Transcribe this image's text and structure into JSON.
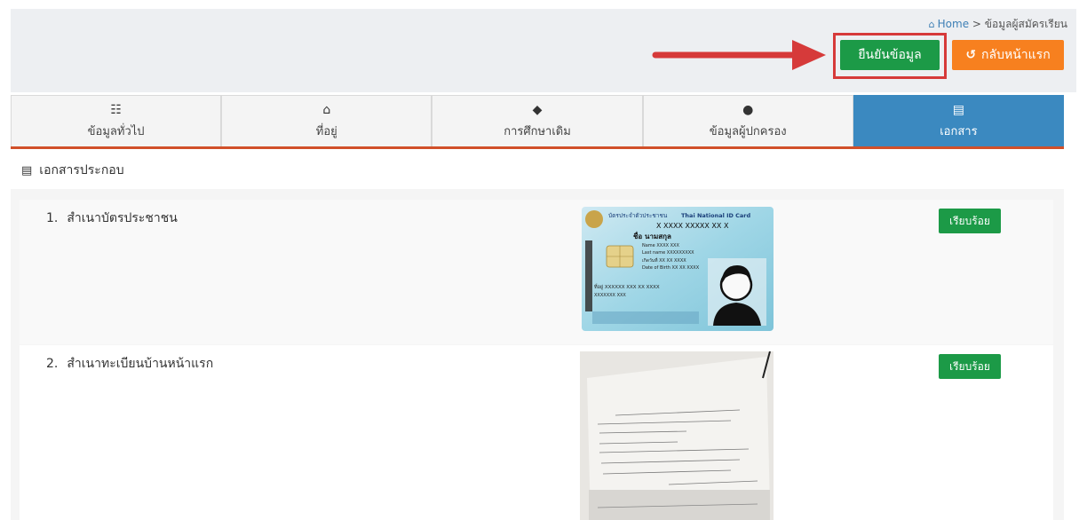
{
  "breadcrumb": {
    "home": "Home",
    "separator": ">",
    "current": "ข้อมูลผู้สมัครเรียน"
  },
  "actions": {
    "confirm_label": "ยืนยันข้อมูล",
    "back_label": "กลับหน้าแรก",
    "confirm_color": "#1c9a47",
    "back_color": "#f7801f",
    "highlight_color": "#d63a3a"
  },
  "tabs": [
    {
      "label": "ข้อมูลทั่วไป",
      "icon": "list-icon",
      "active": false
    },
    {
      "label": "ที่อยู่",
      "icon": "bank-icon",
      "active": false
    },
    {
      "label": "การศึกษาเดิม",
      "icon": "graduation-cap-icon",
      "active": false
    },
    {
      "label": "ข้อมูลผู้ปกครอง",
      "icon": "user-icon",
      "active": false
    },
    {
      "label": "เอกสาร",
      "icon": "book-icon",
      "active": true
    }
  ],
  "section": {
    "title": "เอกสารประกอบ",
    "icon": "book-icon"
  },
  "documents": [
    {
      "number": "1.",
      "label": "สำเนาบัตรประชาชน",
      "status": "เรียบร้อย",
      "image": "thai-national-id-card",
      "card": {
        "title_th": "บัตรประจำตัวประชาชน",
        "title_en": "Thai National ID Card",
        "id_number": "X XXXX XXXXX XX X",
        "name": "ชื่อ นามสกุล",
        "name_en": "Name  XXXX XXX",
        "last_name_en": "Last name  XXXXXXXXX",
        "dob_th": "เกิดวันที่   XX XX XXXX",
        "dob_en": "Date of Birth  XX XX XXXX",
        "address": "ที่อยู่  XXXXXX XXX XX XXXX",
        "address2": "XXXXXXX XXX"
      }
    },
    {
      "number": "2.",
      "label": "สำเนาทะเบียนบ้านหน้าแรก",
      "status": "เรียบร้อย",
      "image": "house-registration-photo"
    }
  ]
}
